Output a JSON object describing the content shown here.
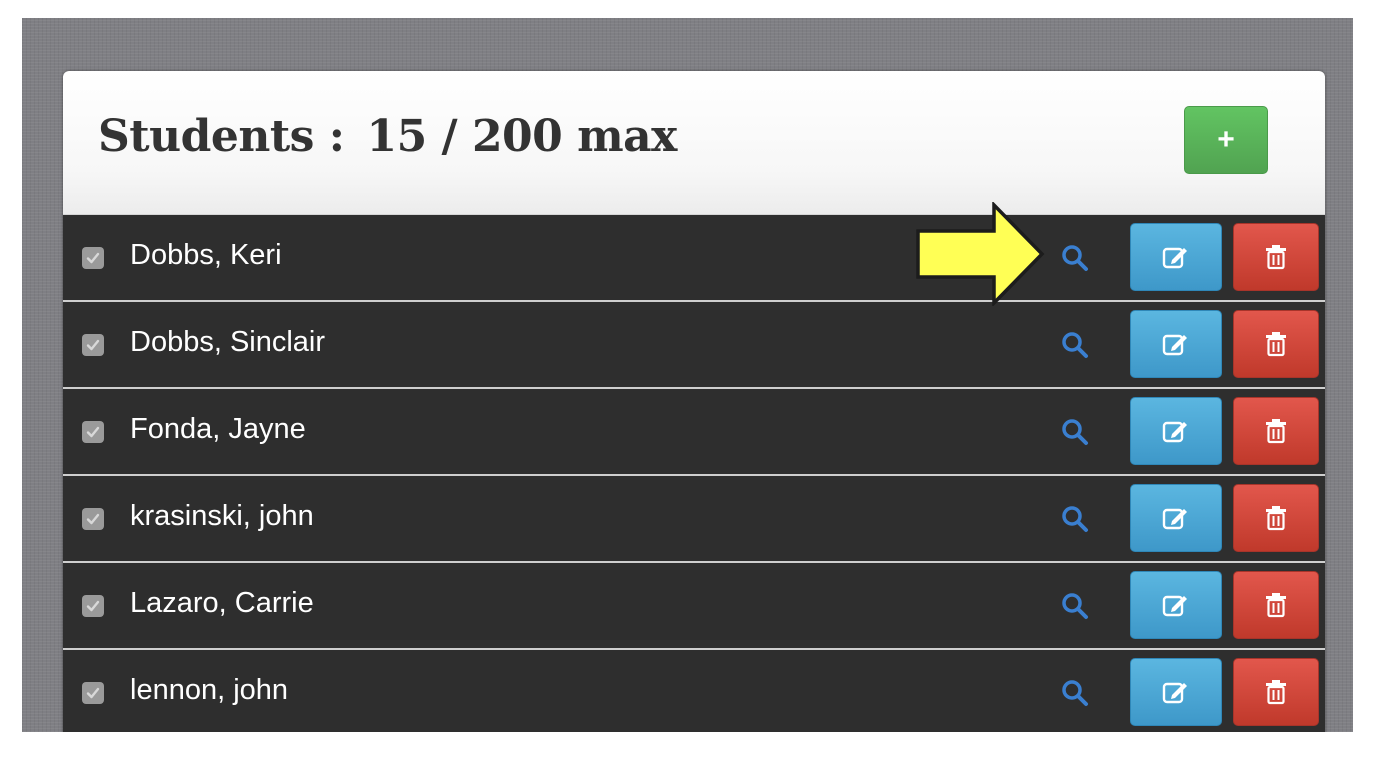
{
  "header": {
    "label": "Students :",
    "count": "15 / 200 max",
    "add_label": "+"
  },
  "students": [
    {
      "name": "Dobbs, Keri",
      "checked": true
    },
    {
      "name": "Dobbs, Sinclair",
      "checked": true
    },
    {
      "name": "Fonda, Jayne",
      "checked": true
    },
    {
      "name": "krasinski, john",
      "checked": true
    },
    {
      "name": "Lazaro, Carrie",
      "checked": true
    },
    {
      "name": "lennon, john",
      "checked": true
    }
  ],
  "icons": {
    "view": "search-icon",
    "edit": "edit-icon",
    "delete": "trash-icon",
    "checkbox": "check-icon",
    "annotation": "arrow-right-icon"
  },
  "colors": {
    "add": "#5cb85c",
    "edit": "#49a7d6",
    "delete": "#d9534f",
    "view": "#3a7fd0",
    "annotation_arrow": "#ffff55"
  }
}
